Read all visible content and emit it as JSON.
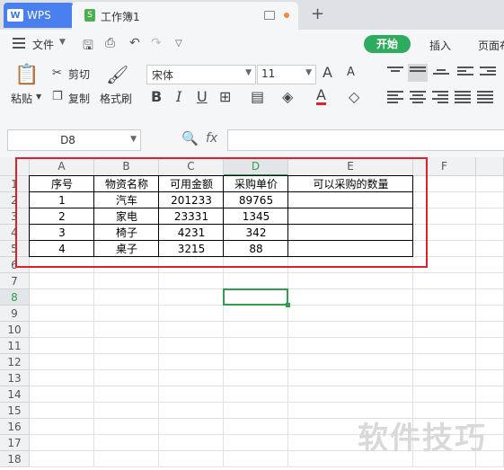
{
  "titlebar": {
    "app_name": "WPS",
    "doc_title": "工作簿1",
    "new_tab": "+"
  },
  "menubar": {
    "file": "文件",
    "start": "开始",
    "insert": "插入",
    "page_layout": "页面布"
  },
  "ribbon": {
    "paste": "粘贴",
    "cut": "剪切",
    "copy": "复制",
    "format_painter": "格式刷",
    "font_name": "宋体",
    "font_size": "11",
    "bold": "B",
    "italic": "I",
    "underline": "U",
    "grow_font": "A",
    "shrink_font": "A",
    "font_color": "A"
  },
  "formulabar": {
    "name_box": "D8",
    "fx": "fx",
    "formula": ""
  },
  "sheet": {
    "columns": [
      "A",
      "B",
      "C",
      "D",
      "E",
      "F"
    ],
    "rows": [
      "1",
      "2",
      "3",
      "4",
      "5",
      "6",
      "7",
      "8",
      "9",
      "10",
      "11",
      "12",
      "13",
      "14",
      "15",
      "16",
      "17",
      "18"
    ],
    "active_column": "D",
    "active_row": "8",
    "header": [
      "序号",
      "物资名称",
      "可用金额",
      "采购单价",
      "可以采购的数量"
    ],
    "data": [
      [
        "1",
        "汽车",
        "201233",
        "89765",
        ""
      ],
      [
        "2",
        "家电",
        "23331",
        "1345",
        ""
      ],
      [
        "3",
        "椅子",
        "4231",
        "342",
        ""
      ],
      [
        "4",
        "桌子",
        "3215",
        "88",
        ""
      ]
    ]
  },
  "colors": {
    "accent_green": "#2eac5d",
    "selection_green": "#2e9f4c",
    "highlight_red": "#e0202a",
    "wps_blue": "#4a7ff0"
  },
  "watermark": "软件技巧"
}
